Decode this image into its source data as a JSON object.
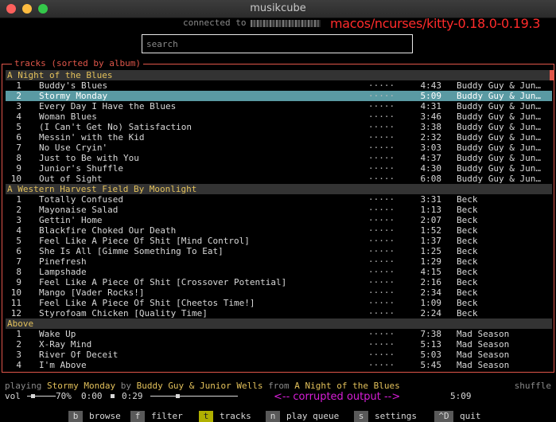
{
  "window": {
    "title": "musikcube"
  },
  "header": {
    "connected_label": "connected to",
    "overlay_note": "macos/ncurses/kitty-0.18.0-0.19.3"
  },
  "search": {
    "placeholder": "search",
    "value": ""
  },
  "panel": {
    "title": "tracks (sorted by album)"
  },
  "albums": [
    {
      "title": "A Night of the Blues",
      "tracks": [
        {
          "num": "1",
          "title": "Buddy's Blues",
          "rating": "·····",
          "duration": "4:43",
          "artist": "Buddy Guy & Jun…"
        },
        {
          "num": "2",
          "title": "Stormy Monday",
          "rating": "·····",
          "duration": "5:09",
          "artist": "Buddy Guy & Jun…",
          "selected": true
        },
        {
          "num": "3",
          "title": "Every Day I Have the Blues",
          "rating": "·····",
          "duration": "4:31",
          "artist": "Buddy Guy & Jun…"
        },
        {
          "num": "4",
          "title": "Woman Blues",
          "rating": "·····",
          "duration": "3:46",
          "artist": "Buddy Guy & Jun…"
        },
        {
          "num": "5",
          "title": "(I Can't Get No) Satisfaction",
          "rating": "·····",
          "duration": "3:38",
          "artist": "Buddy Guy & Jun…"
        },
        {
          "num": "6",
          "title": "Messin' with the Kid",
          "rating": "·····",
          "duration": "2:32",
          "artist": "Buddy Guy & Jun…"
        },
        {
          "num": "7",
          "title": "No Use Cryin'",
          "rating": "·····",
          "duration": "3:03",
          "artist": "Buddy Guy & Jun…"
        },
        {
          "num": "8",
          "title": "Just to Be with You",
          "rating": "·····",
          "duration": "4:37",
          "artist": "Buddy Guy & Jun…"
        },
        {
          "num": "9",
          "title": "Junior's Shuffle",
          "rating": "·····",
          "duration": "4:30",
          "artist": "Buddy Guy & Jun…"
        },
        {
          "num": "10",
          "title": "Out of Sight",
          "rating": "·····",
          "duration": "6:08",
          "artist": "Buddy Guy & Jun…"
        }
      ]
    },
    {
      "title": "A Western Harvest Field By Moonlight",
      "tracks": [
        {
          "num": "1",
          "title": "Totally Confused",
          "rating": "·····",
          "duration": "3:31",
          "artist": "Beck"
        },
        {
          "num": "2",
          "title": "Mayonaise Salad",
          "rating": "·····",
          "duration": "1:13",
          "artist": "Beck"
        },
        {
          "num": "3",
          "title": "Gettin' Home",
          "rating": "·····",
          "duration": "2:07",
          "artist": "Beck"
        },
        {
          "num": "4",
          "title": "Blackfire Choked Our Death",
          "rating": "·····",
          "duration": "1:52",
          "artist": "Beck"
        },
        {
          "num": "5",
          "title": "Feel Like A Piece Of Shit [Mind Control]",
          "rating": "·····",
          "duration": "1:37",
          "artist": "Beck"
        },
        {
          "num": "6",
          "title": "She Is All [Gimme Something To Eat]",
          "rating": "·····",
          "duration": "1:25",
          "artist": "Beck"
        },
        {
          "num": "7",
          "title": "Pinefresh",
          "rating": "·····",
          "duration": "1:29",
          "artist": "Beck"
        },
        {
          "num": "8",
          "title": "Lampshade",
          "rating": "·····",
          "duration": "4:15",
          "artist": "Beck"
        },
        {
          "num": "9",
          "title": "Feel Like A Piece Of Shit [Crossover Potential]",
          "rating": "·····",
          "duration": "2:16",
          "artist": "Beck"
        },
        {
          "num": "10",
          "title": "Mango [Vader Rocks!]",
          "rating": "·····",
          "duration": "2:34",
          "artist": "Beck"
        },
        {
          "num": "11",
          "title": "Feel Like A Piece Of Shit [Cheetos Time!]",
          "rating": "·····",
          "duration": "1:09",
          "artist": "Beck"
        },
        {
          "num": "12",
          "title": "Styrofoam Chicken [Quality Time]",
          "rating": "·····",
          "duration": "2:24",
          "artist": "Beck"
        }
      ]
    },
    {
      "title": "Above",
      "tracks": [
        {
          "num": "1",
          "title": "Wake Up",
          "rating": "·····",
          "duration": "7:38",
          "artist": "Mad Season"
        },
        {
          "num": "2",
          "title": "X-Ray Mind",
          "rating": "·····",
          "duration": "5:13",
          "artist": "Mad Season"
        },
        {
          "num": "3",
          "title": "River Of Deceit",
          "rating": "·····",
          "duration": "5:03",
          "artist": "Mad Season"
        },
        {
          "num": "4",
          "title": "I'm Above",
          "rating": "·····",
          "duration": "5:45",
          "artist": "Mad Season"
        }
      ]
    }
  ],
  "status": {
    "playing_label": "playing",
    "track": "Stormy Monday",
    "by_label": "by",
    "artist": "Buddy Guy & Junior Wells",
    "from_label": "from",
    "album": "A Night of the Blues",
    "shuffle_label": "shuffle"
  },
  "transport": {
    "vol_label": "vol",
    "volume_text": "70%",
    "volume_fraction": 0.7,
    "position": "0:00",
    "elapsed": "0:29",
    "progress_fraction": 0.09,
    "corrupt_note": "<-- corrupted output -->",
    "duration": "5:09"
  },
  "footer": {
    "items": [
      {
        "key": "b",
        "label": "browse"
      },
      {
        "key": "f",
        "label": "filter"
      },
      {
        "key": "t",
        "label": "tracks",
        "active": true
      },
      {
        "key": "n",
        "label": "play queue"
      },
      {
        "key": "s",
        "label": "settings"
      },
      {
        "key": "^D",
        "label": "quit"
      }
    ]
  },
  "colors": {
    "accent": "#e0564a",
    "album_header": "#e3c15b",
    "selection": "#5a9aa3",
    "active_key": "#b0b000",
    "overlay_red": "#ff2b2b",
    "overlay_magenta": "#d81ed8"
  }
}
